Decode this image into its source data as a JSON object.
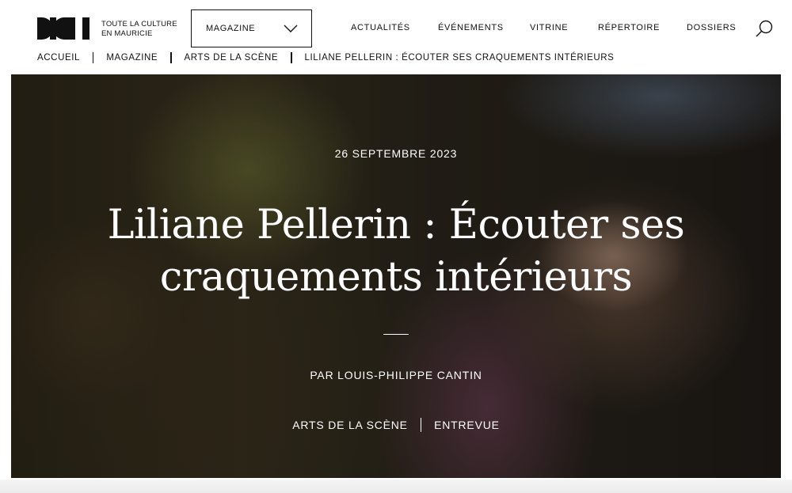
{
  "header": {
    "logo_icon": "dici-logo-icon",
    "tagline_line1": "TOUTE LA CULTURE",
    "tagline_line2": "EN MAURICIE",
    "section_select": {
      "value": "MAGAZINE",
      "icon": "chevron-down-icon"
    },
    "nav": {
      "actualites": "ACTUALITÉS",
      "evenements": "ÉVÉNEMENTS",
      "vitrine": "VITRINE",
      "repertoire": "RÉPERTOIRE",
      "dossiers": "DOSSIERS"
    },
    "search_icon": "search-icon"
  },
  "breadcrumb": {
    "home": "ACCUEIL",
    "section": "MAGAZINE",
    "category": "ARTS DE LA SCÈNE",
    "current": "LILIANE PELLERIN : ÉCOUTER SES CRAQUEMENTS INTÉRIEURS"
  },
  "hero": {
    "date": "26 SEPTEMBRE 2023",
    "title": "Liliane Pellerin : Écouter ses craquements intérieurs",
    "author": "PAR LOUIS-PHILIPPE CANTIN",
    "tags": {
      "tag1": "ARTS DE LA SCÈNE",
      "tag2": "ENTREVUE"
    }
  },
  "colors": {
    "text": "#111111",
    "hero_text": "#ffffff",
    "background": "#ffffff"
  }
}
